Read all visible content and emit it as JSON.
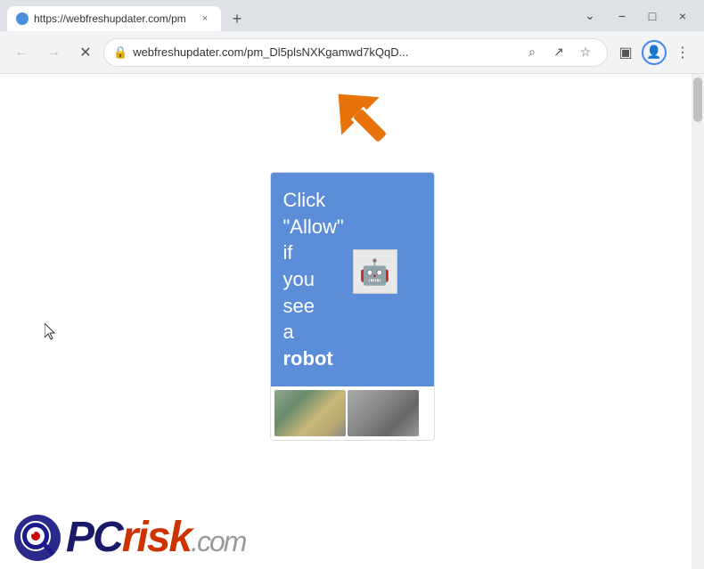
{
  "titlebar": {
    "tab": {
      "title": "https://webfreshupdater.com/pm",
      "close_label": "×"
    },
    "new_tab_label": "+",
    "minimize_label": "−",
    "maximize_label": "□",
    "close_label": "×",
    "chevron_label": "⌄"
  },
  "addressbar": {
    "back_label": "←",
    "forward_label": "→",
    "reload_label": "✕",
    "url": "webfreshupdater.com/pm_Dl5plsNXKgamwd7kQqD...",
    "search_label": "⌕",
    "share_label": "↗",
    "bookmark_label": "☆",
    "sidebar_label": "▣",
    "profile_label": "👤",
    "menu_label": "⋮"
  },
  "page": {
    "notification_text_line1": "Click",
    "notification_text_line2": "\"Allow\"",
    "notification_text_line3": "if",
    "notification_text_line4": "you",
    "notification_text_line5": "see",
    "notification_text_line6": "a",
    "notification_text_bold": "robot",
    "notification_full": "Click \"Allow\" if you see a robot",
    "robot_emoji": "🤖"
  },
  "logo": {
    "pc": "PC",
    "risk": "risk",
    "dotcom": ".com"
  },
  "colors": {
    "blue_card": "#5b8dd9",
    "arrow_orange": "#e8730a",
    "logo_blue": "#1a1a6a",
    "logo_red": "#cc3300"
  }
}
